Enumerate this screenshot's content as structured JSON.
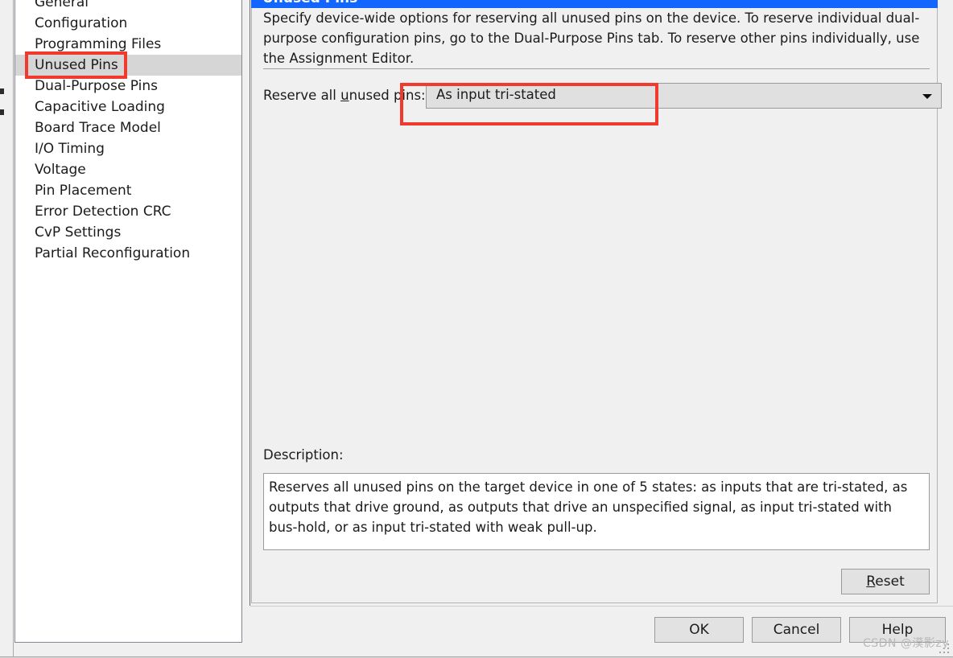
{
  "window": {
    "dialog_title": "Unused Pins"
  },
  "sidebar": {
    "name": "category-tree",
    "items": [
      {
        "label": "General",
        "selected": false
      },
      {
        "label": "Configuration",
        "selected": false
      },
      {
        "label": "Programming Files",
        "selected": false
      },
      {
        "label": "Unused Pins",
        "selected": true
      },
      {
        "label": "Dual-Purpose Pins",
        "selected": false
      },
      {
        "label": "Capacitive Loading",
        "selected": false
      },
      {
        "label": "Board Trace Model",
        "selected": false
      },
      {
        "label": "I/O Timing",
        "selected": false
      },
      {
        "label": "Voltage",
        "selected": false
      },
      {
        "label": "Pin Placement",
        "selected": false
      },
      {
        "label": "Error Detection CRC",
        "selected": false
      },
      {
        "label": "CvP Settings",
        "selected": false
      },
      {
        "label": "Partial Reconfiguration",
        "selected": false
      }
    ]
  },
  "main": {
    "intro_text": "Specify device-wide options for reserving all unused pins on the device. To reserve individual dual-purpose configuration pins, go to the Dual-Purpose Pins tab. To reserve other pins individually, use the Assignment Editor.",
    "reserve_row": {
      "label_before": "Reserve all ",
      "label_mnemonic": "u",
      "label_after": "nused pins:",
      "combo_value": "As input tri-stated",
      "combo_arrow_icon": "chevron-down-icon"
    },
    "description": {
      "label": "Description:",
      "text": "Reserves all unused pins on the target device in one of 5 states: as inputs that are tri-stated, as outputs that drive ground, as outputs that drive an unspecified signal, as input tri-stated with bus-hold, or as input tri-stated with weak pull-up."
    },
    "reset_button": {
      "label_mnemonic": "R",
      "label_rest": "eset"
    }
  },
  "footer": {
    "ok_label": "OK",
    "cancel_label": "Cancel",
    "help_label": "Help"
  },
  "overlay": {
    "watermark": "CSDN @漠影zy",
    "highlight_color": "#f03a2e"
  }
}
